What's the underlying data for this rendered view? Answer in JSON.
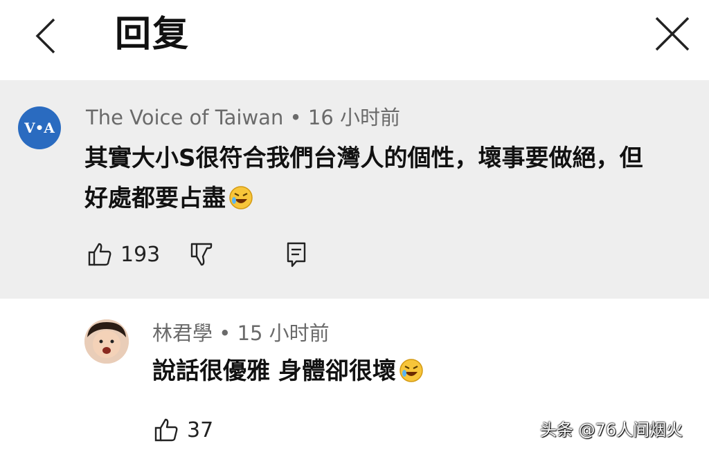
{
  "header": {
    "title": "回复"
  },
  "comments": [
    {
      "avatar_text": "V•A",
      "author": "The Voice of Taiwan",
      "time": "16 小时前",
      "text": "其實大小S很符合我們台灣人的個性，壞事要做絕，但好處都要占盡",
      "likes": "193"
    },
    {
      "author": "林君學",
      "time": "15 小时前",
      "text": "說話很優雅 身體卻很壞",
      "likes": "37"
    }
  ],
  "watermark": "头条 @76人间烟火",
  "colors": {
    "comment_bg": "#eeeeee",
    "avatar_blue": "#2a6bc0",
    "meta_gray": "#6a6a6a"
  }
}
